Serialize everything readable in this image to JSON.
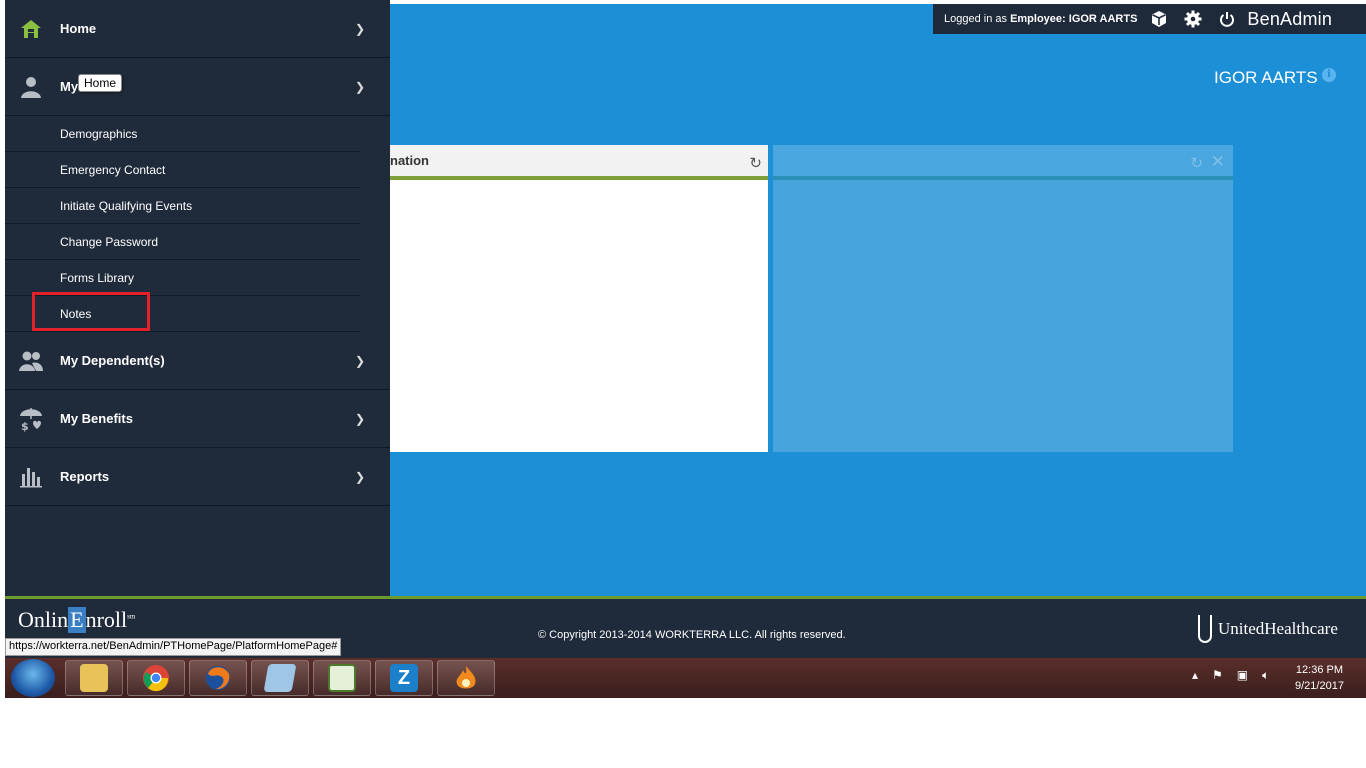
{
  "topbar": {
    "logged_prefix": "Logged in as",
    "logged_role": "Employee:",
    "logged_user": "IGOR AARTS",
    "brand": "BenAdmin",
    "icons": [
      "cube-icon",
      "gear-icon",
      "power-icon"
    ]
  },
  "user": {
    "name": "IGOR AARTS"
  },
  "tooltip": "Home",
  "sidebar": {
    "main": [
      {
        "label": "Home",
        "icon": "home-icon"
      },
      {
        "label": "My",
        "icon": "person-icon"
      },
      {
        "label": "My Dependent(s)",
        "icon": "people-icon"
      },
      {
        "label": "My Benefits",
        "icon": "umbrella-icon"
      },
      {
        "label": "Reports",
        "icon": "bar-chart-icon"
      }
    ],
    "sub": [
      {
        "label": "Demographics"
      },
      {
        "label": "Emergency Contact"
      },
      {
        "label": "Initiate Qualifying Events"
      },
      {
        "label": "Change Password"
      },
      {
        "label": "Forms Library"
      },
      {
        "label": "Notes"
      }
    ]
  },
  "widget1": {
    "title": "nation"
  },
  "footer": {
    "logo_a": "Onlin",
    "logo_e": "E",
    "logo_b": "nroll",
    "logo_sm": "sm",
    "copyright": "© Copyright 2013-2014 WORKTERRA LLC. All rights reserved.",
    "partner": "UnitedHealthcare"
  },
  "status_url": "https://workterra.net/BenAdmin/PTHomePage/PlatformHomePage#",
  "taskbar": {
    "apps": [
      "file-explorer-icon",
      "chrome-icon",
      "firefox-icon",
      "notepad-icon",
      "spreadsheet-icon",
      "z-app-icon",
      "flame-app-icon"
    ],
    "z_label": "Z",
    "time": "12:36 PM",
    "date": "9/21/2017"
  },
  "colors": {
    "canvas": "#1c8fd6",
    "sidebar": "#1f2b3b",
    "accent_green": "#7ea03a",
    "highlight_red": "#e2212c"
  }
}
